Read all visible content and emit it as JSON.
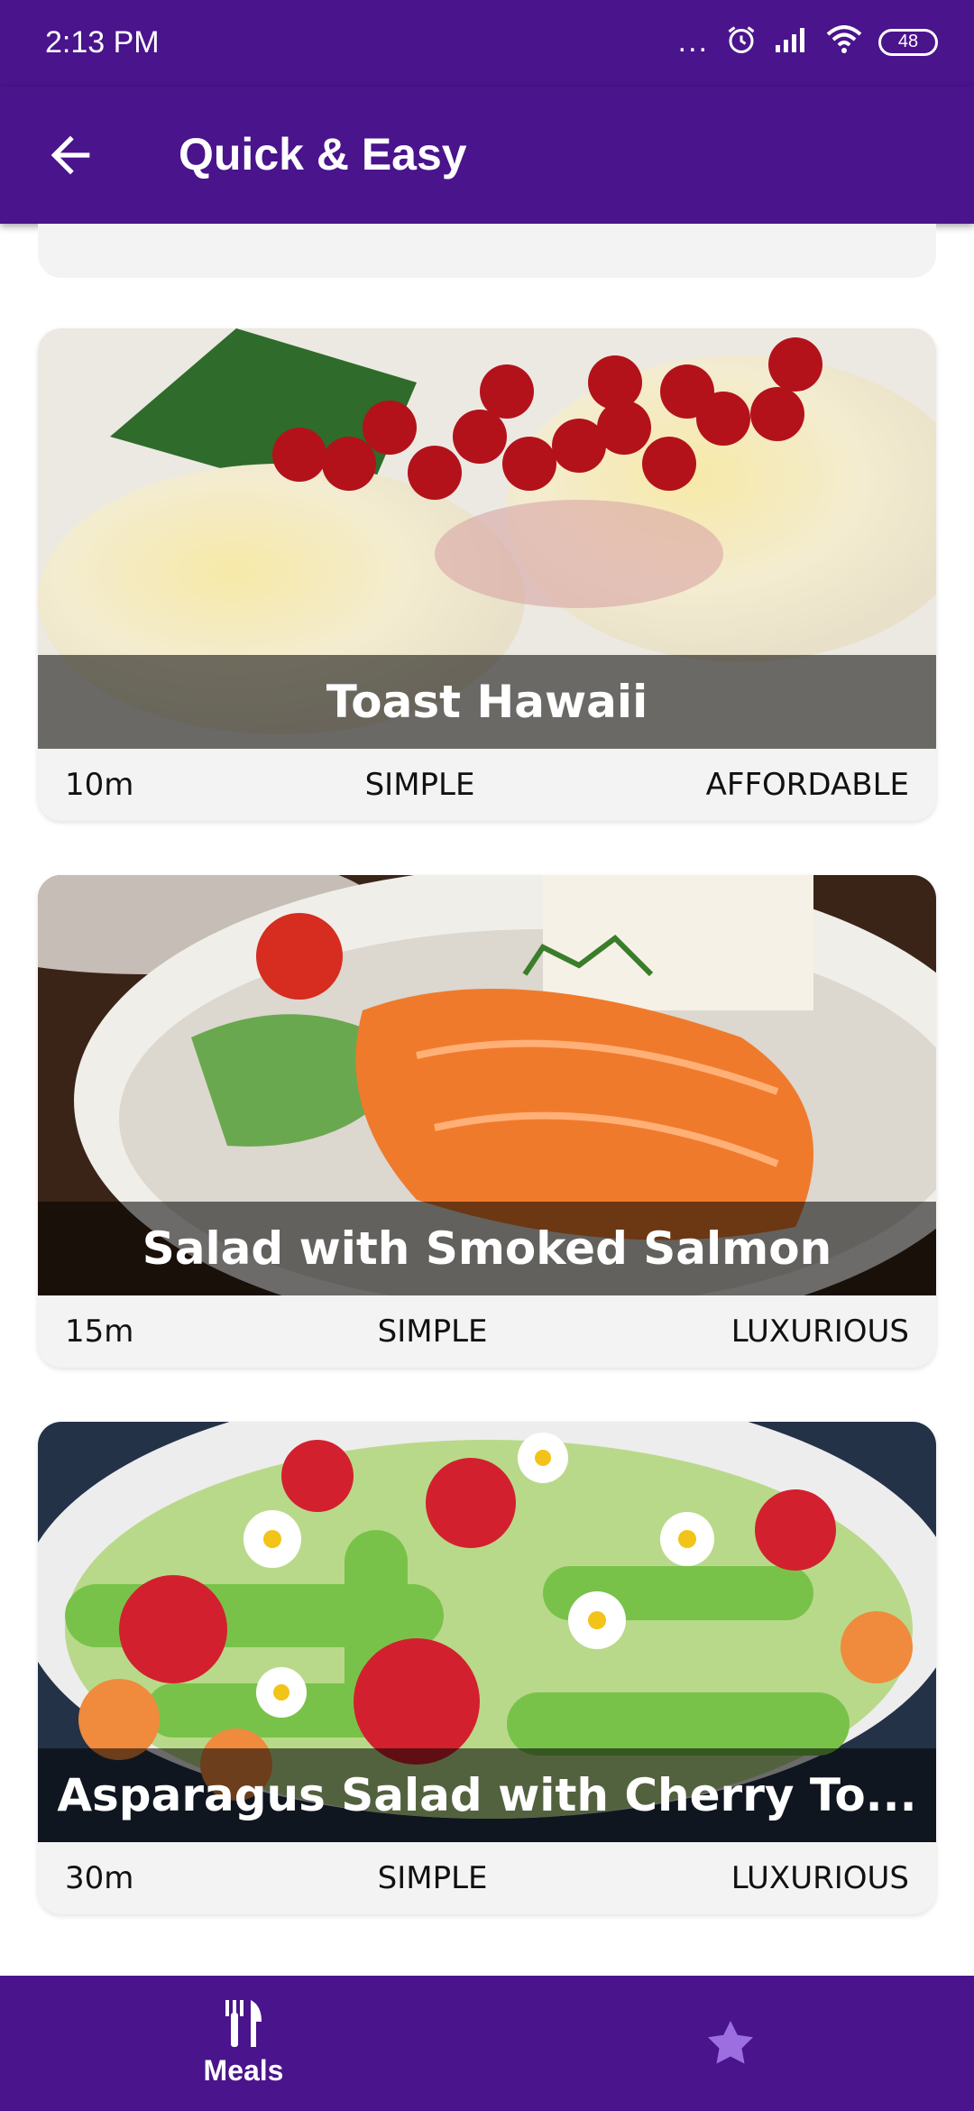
{
  "status": {
    "time": "2:13 PM",
    "dots": "...",
    "battery": "48"
  },
  "appbar": {
    "title": "Quick & Easy"
  },
  "meals": [
    {
      "title": "Toast Hawaii",
      "duration": "10m",
      "complexity": "SIMPLE",
      "affordability": "AFFORDABLE"
    },
    {
      "title": "Salad with Smoked Salmon",
      "duration": "15m",
      "complexity": "SIMPLE",
      "affordability": "LUXURIOUS"
    },
    {
      "title": "Asparagus Salad with Cherry To...",
      "duration": "30m",
      "complexity": "SIMPLE",
      "affordability": "LUXURIOUS"
    }
  ],
  "bottom_nav": {
    "meals_label": "Meals"
  },
  "colors": {
    "primary": "#4A148C",
    "card_bg": "#f3f3f3",
    "nav_inactive_icon": "#9c6ee0"
  }
}
